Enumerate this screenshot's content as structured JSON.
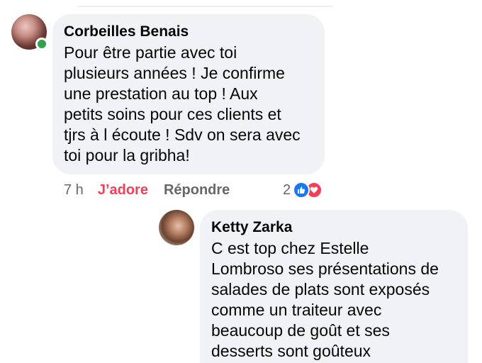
{
  "comments": [
    {
      "author": "Corbeilles Benais",
      "text": "Pour être partie avec toi\nplusieurs années ! Je confirme\nune prestation au top ! Aux\npetits soins pour ces clients et\ntjrs à l écoute ! Sdv on sera avec\ntoi pour la gribha!",
      "online": true,
      "time": "7 h",
      "love_label": "J’adore",
      "reply_label": "Répondre",
      "reaction_count": "2",
      "reactions": [
        "like-icon",
        "heart-icon"
      ]
    },
    {
      "author": "Ketty Zarka",
      "text": "C est top chez Estelle\nLombroso ses présentations de\nsalades de plats sont exposés\ncomme un traiteur avec\nbeaucoup de goût et ses\ndesserts sont goûteux"
    }
  ],
  "colors": {
    "bubble": "#f0f2f5",
    "love": "#f33e58",
    "like": "#1877f2",
    "secondary_text": "#65676b",
    "online": "#31a24c"
  }
}
